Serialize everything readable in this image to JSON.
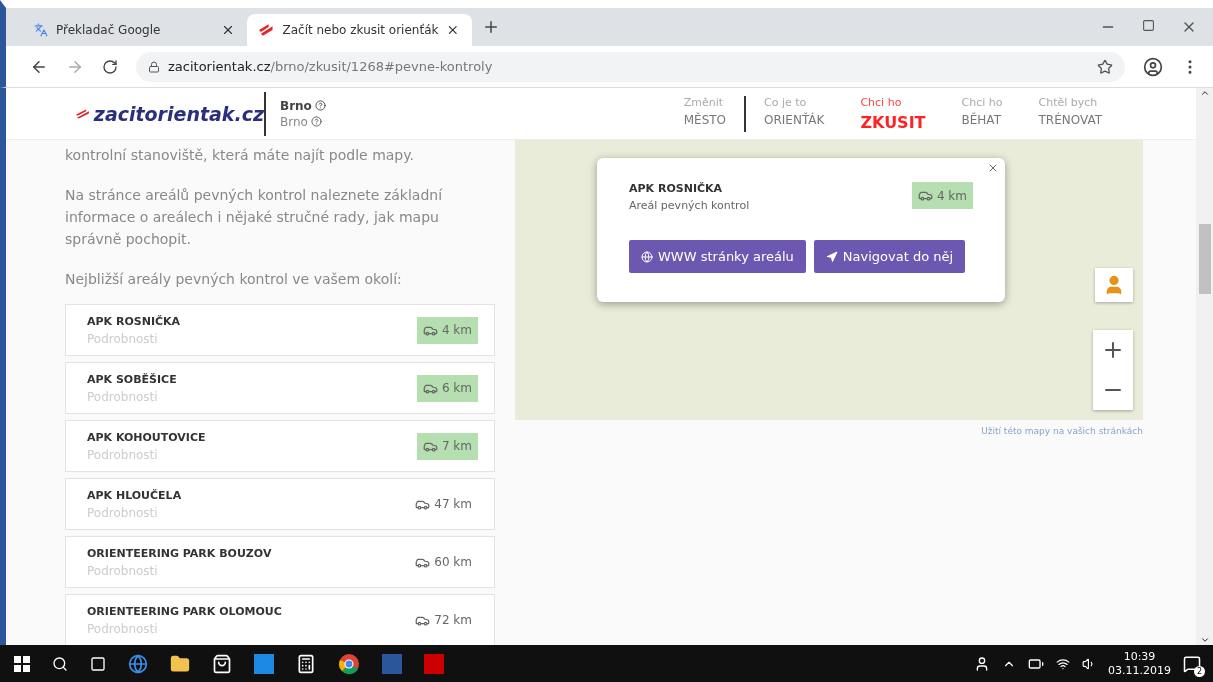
{
  "browser": {
    "tabs": [
      {
        "title": "Překladač Google",
        "selected": false,
        "kind": "translate"
      },
      {
        "title": "Začít nebo zkusit orienťák",
        "selected": true,
        "kind": "site"
      }
    ],
    "url_host": "zacitorientak.cz",
    "url_path": "/brno/zkusit/1268#pevne-kontroly"
  },
  "header": {
    "logo": "zacitorientak.cz",
    "city": "Brno",
    "city_sub": "Brno",
    "nav": [
      {
        "small": "Změnit",
        "label": "MĚSTO",
        "selected": false
      },
      {
        "small": "Co je to",
        "label": "ORIENŤÁK",
        "selected": false
      },
      {
        "small": "Chci ho",
        "label": "ZKUSIT",
        "selected": true
      },
      {
        "small": "Chci ho",
        "label": "BĚHAT",
        "selected": false
      },
      {
        "small": "Chtěl bych",
        "label": "TRÉNOVAT",
        "selected": false
      }
    ]
  },
  "paragraphs": [
    "kontrolní stanoviště, která máte najít podle mapy.",
    "Na stránce areálů pevných kontrol naleznete základní informace o areálech i nějaké stručné rady, jak mapu správně pochopit.",
    "Nejbližší areály pevných kontrol ve vašem okolí:"
  ],
  "areas": [
    {
      "name": "APK ROSNIČKA",
      "link": "Podrobnosti",
      "distance": "4 km",
      "near": true
    },
    {
      "name": "APK SOBĚŠICE",
      "link": "Podrobnosti",
      "distance": "6 km",
      "near": true
    },
    {
      "name": "APK KOHOUTOVICE",
      "link": "Podrobnosti",
      "distance": "7 km",
      "near": true
    },
    {
      "name": "APK HLOUČELA",
      "link": "Podrobnosti",
      "distance": "47 km",
      "near": false
    },
    {
      "name": "ORIENTEERING PARK BOUZOV",
      "link": "Podrobnosti",
      "distance": "60 km",
      "near": false
    },
    {
      "name": "ORIENTEERING PARK OLOMOUC",
      "link": "Podrobnosti",
      "distance": "72 km",
      "near": false
    }
  ],
  "map": {
    "popup": {
      "name": "APK ROSNIČKA",
      "subtitle": "Areál pevných kontrol",
      "distance": "4 km",
      "near": true,
      "buttons": [
        {
          "label": "WWW stránky areálu",
          "kind": "web"
        },
        {
          "label": "Navigovat do něj",
          "kind": "navigate"
        }
      ]
    },
    "attribution": "Užití této mapy na vašich stránkách"
  },
  "taskbar": {
    "time": "10:39",
    "date": "03.11.2019",
    "notifications": "2"
  }
}
